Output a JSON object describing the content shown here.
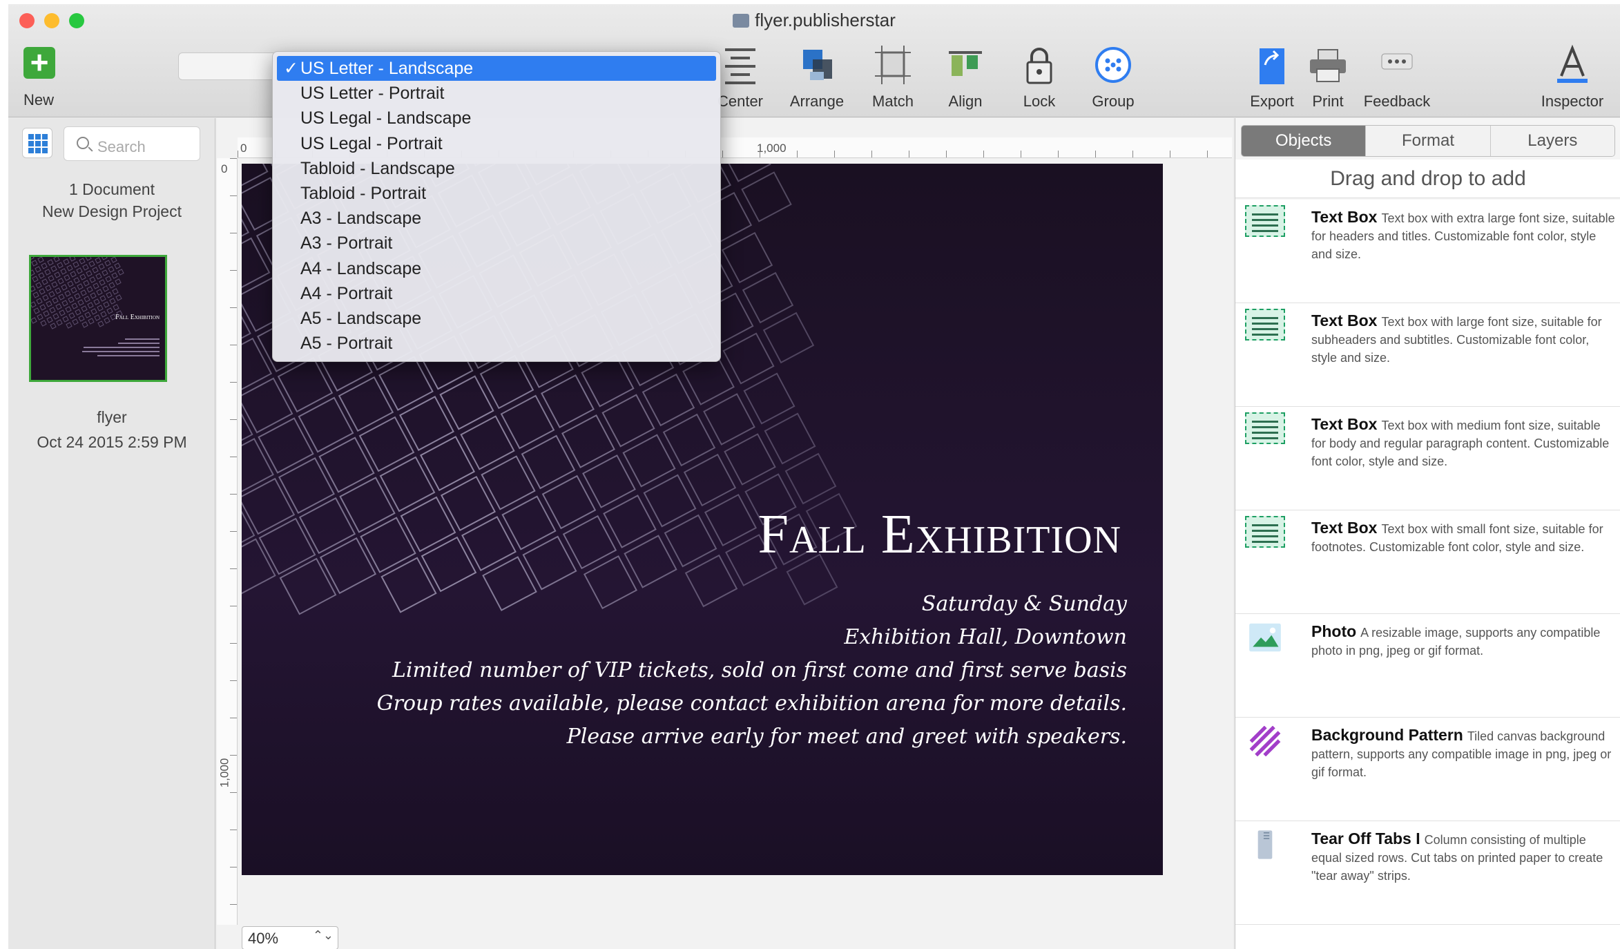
{
  "window": {
    "title": "flyer.publisherstar"
  },
  "toolbar": {
    "new_label": "New",
    "items": [
      {
        "label": "Center",
        "icon": "center-align-icon"
      },
      {
        "label": "Arrange",
        "icon": "arrange-icon"
      },
      {
        "label": "Match",
        "icon": "match-size-icon"
      },
      {
        "label": "Align",
        "icon": "align-icon"
      },
      {
        "label": "Lock",
        "icon": "lock-icon"
      },
      {
        "label": "Group",
        "icon": "group-icon"
      },
      {
        "label": "Export",
        "icon": "export-icon"
      },
      {
        "label": "Print",
        "icon": "print-icon"
      },
      {
        "label": "Feedback",
        "icon": "feedback-icon"
      },
      {
        "label": "Inspector",
        "icon": "inspector-icon"
      }
    ]
  },
  "page_size_menu": {
    "selected_index": 0,
    "options": [
      "US Letter - Landscape",
      "US Letter - Portrait",
      "US Legal - Landscape",
      "US Legal - Portrait",
      "Tabloid - Landscape",
      "Tabloid - Portrait",
      "A3 - Landscape",
      "A3 - Portrait",
      "A4 - Landscape",
      "A4 - Portrait",
      "A5 - Landscape",
      "A5 - Portrait"
    ]
  },
  "sidebar": {
    "search_placeholder": "Search",
    "doc_count": "1 Document",
    "project_name": "New Design Project",
    "thumbnail": {
      "name": "flyer",
      "date": "Oct 24 2015 2:59 PM",
      "mini_title": "Fall Exhibition"
    }
  },
  "ruler": {
    "top_labels": [
      "0",
      "1,000"
    ],
    "left_labels": [
      "0",
      "1,000"
    ]
  },
  "flyer": {
    "title": "Fall Exhibition",
    "lines": [
      "Saturday & Sunday",
      "Exhibition Hall, Downtown",
      "Limited number of VIP tickets, sold on first come and first serve basis",
      "Group rates available, please contact exhibition arena for more details.",
      "Please arrive early for meet and greet with speakers."
    ]
  },
  "zoom": {
    "value": "40%"
  },
  "inspector": {
    "tabs": [
      "Objects",
      "Format",
      "Layers"
    ],
    "active_tab": "Objects",
    "drag_hint": "Drag and drop to add",
    "objects": [
      {
        "name": "Text Box",
        "desc": "Text box with extra large font size, suitable for headers and titles. Customizable font color, style and size.",
        "icon": "text-box-icon"
      },
      {
        "name": "Text Box",
        "desc": "Text box with large font size, suitable for subheaders and subtitles. Customizable font color, style and size.",
        "icon": "text-box-icon"
      },
      {
        "name": "Text Box",
        "desc": "Text box with medium font size, suitable for body and regular paragraph content. Customizable font color, style and size.",
        "icon": "text-box-icon"
      },
      {
        "name": "Text Box",
        "desc": "Text box with small font size, suitable for footnotes. Customizable font color, style and size.",
        "icon": "text-box-icon"
      },
      {
        "name": "Photo",
        "desc": "A resizable image, supports any compatible photo in png, jpeg or gif format.",
        "icon": "photo-icon"
      },
      {
        "name": "Background Pattern",
        "desc": "Tiled canvas background pattern, supports any compatible image in png, jpeg or gif format.",
        "icon": "pattern-icon"
      },
      {
        "name": "Tear Off Tabs I",
        "desc": "Column consisting of multiple equal sized rows. Cut tabs on printed paper to create \"tear away\" strips.",
        "icon": "tear-off-tabs-icon"
      }
    ]
  },
  "colors": {
    "accent": "#2f7df0",
    "green": "#3ea83b",
    "flyer_bg": "#1f1226"
  }
}
